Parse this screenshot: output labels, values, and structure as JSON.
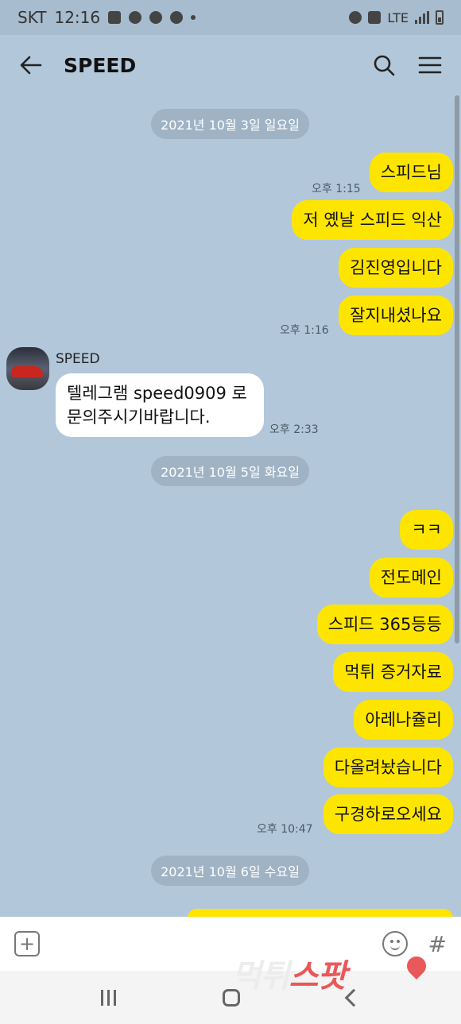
{
  "status_bar": {
    "carrier": "SKT",
    "time": "12:16",
    "network": "LTE"
  },
  "header": {
    "title": "SPEED"
  },
  "dates": [
    "2021년 10월 3일 일요일",
    "2021년 10월 5일 화요일",
    "2021년 10월 6일 수요일"
  ],
  "messages": {
    "m1": "스피드님",
    "m2": "저 옜날 스피드 익산",
    "m3": "김진영입니다",
    "m4": "잘지내셨나요",
    "reply": "텔레그램 speed0909 로 문의주시기바랍니다.",
    "m5": "ㅋㅋ",
    "m6": "전도메인",
    "m7": "스피드 365등등",
    "m8": "먹튀 증거자료",
    "m9": "아레나쥴리",
    "m10": "다올려놨습니다",
    "m11": "구경하로오세요"
  },
  "times": {
    "t1": "오후 1:15",
    "t2": "오후 1:16",
    "t3": "오후 2:33",
    "t4": "오후 10:47"
  },
  "sender_name": "SPEED",
  "input": {
    "placeholder": ""
  },
  "watermark": {
    "part1": "먹튀",
    "part2": "스팟"
  },
  "colors": {
    "chat_bg": "#b2c7da",
    "my_bubble": "#fee500",
    "their_bubble": "#ffffff"
  }
}
